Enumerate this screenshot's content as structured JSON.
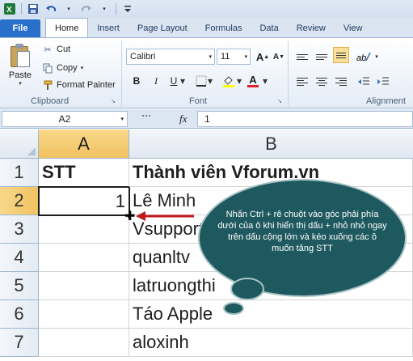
{
  "ribbon": {
    "tabs": [
      "File",
      "Home",
      "Insert",
      "Page Layout",
      "Formulas",
      "Data",
      "Review",
      "View"
    ],
    "active_tab": "Home",
    "clipboard": {
      "paste_label": "Paste",
      "cut_label": "Cut",
      "copy_label": "Copy",
      "format_painter_label": "Format Painter",
      "group_label": "Clipboard"
    },
    "font": {
      "family": "Calibri",
      "size": "11",
      "bold": "B",
      "italic": "I",
      "underline": "U",
      "font_color_letter": "A",
      "group_label": "Font"
    },
    "alignment": {
      "group_label": "Alignment"
    }
  },
  "formula_bar": {
    "name_box": "A2",
    "fx_label": "fx",
    "value": "1"
  },
  "sheet": {
    "columns": [
      "A",
      "B"
    ],
    "selected_column": "A",
    "rows": [
      "1",
      "2",
      "3",
      "4",
      "5",
      "6",
      "7"
    ],
    "selected_row": "2",
    "cells": {
      "a1": "STT",
      "b1": "Thành viên Vforum.vn",
      "a2": "1",
      "b2": "Lê Minh",
      "b3": "Vsupport",
      "b4": "quanltv",
      "b5": "latruongthi",
      "b6": "Táo Apple",
      "b7": "aloxinh"
    }
  },
  "callout": {
    "text": "Nhấn Ctrl + rê chuột vào góc phải phía dưới của ô khi hiển thị dấu + nhỏ nhỏ ngay trên dấu cộng lớn và kéo xuống các ô muốn tăng STT",
    "fill_color": "#1f5960",
    "border_color": "#a9c4c6"
  },
  "arrow_color": "#c0191c"
}
